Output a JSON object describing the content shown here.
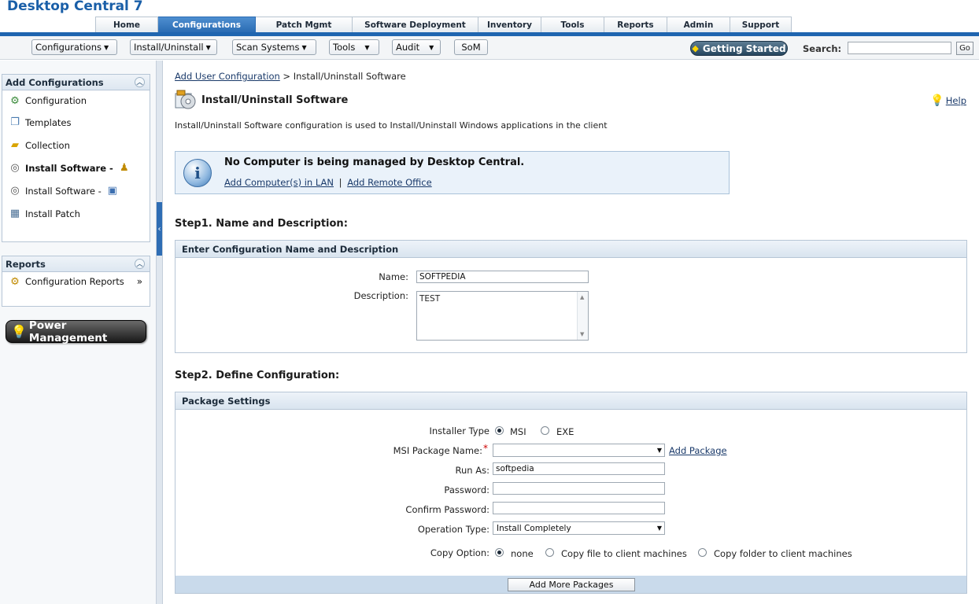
{
  "app": {
    "title": "Desktop Central 7"
  },
  "main_tabs": [
    {
      "label": "Home",
      "active": false
    },
    {
      "label": "Configurations",
      "active": true
    },
    {
      "label": "Patch Mgmt",
      "active": false
    },
    {
      "label": "Software Deployment",
      "active": false
    },
    {
      "label": "Inventory",
      "active": false
    },
    {
      "label": "Tools",
      "active": false
    },
    {
      "label": "Reports",
      "active": false
    },
    {
      "label": "Admin",
      "active": false
    },
    {
      "label": "Support",
      "active": false
    }
  ],
  "toolbar": {
    "menus": [
      {
        "label": "Configurations",
        "caret": "▼"
      },
      {
        "label": "Install/Uninstall",
        "caret": "▼"
      },
      {
        "label": "Scan Systems",
        "caret": "▼"
      },
      {
        "label": "Tools",
        "caret": "▼"
      },
      {
        "label": "Audit",
        "caret": "▼"
      },
      {
        "label": "SoM",
        "caret": ""
      }
    ],
    "getting_started": "Getting Started",
    "search_label": "Search:",
    "search_value": "",
    "go_label": "Go"
  },
  "sidebar": {
    "add_config_title": "Add Configurations",
    "add_config_items": [
      {
        "label": "Configuration",
        "icon": "gear-add-icon"
      },
      {
        "label": "Templates",
        "icon": "templates-icon"
      },
      {
        "label": "Collection",
        "icon": "collection-icon"
      },
      {
        "label": "Install Software -",
        "icon": "software-cd-icon",
        "suffix_icon": "user-icon"
      },
      {
        "label": "Install Software -",
        "icon": "software-cd-icon",
        "suffix_icon": "computer-icon"
      },
      {
        "label": "Install Patch",
        "icon": "patch-icon"
      }
    ],
    "reports_title": "Reports",
    "reports_items": [
      {
        "label": "Configuration Reports",
        "icon": "reports-gear-icon"
      }
    ],
    "power_management": "Power Management"
  },
  "content": {
    "breadcrumb_link": "Add User Configuration",
    "breadcrumb_sep": " > ",
    "breadcrumb_current": "Install/Uninstall Software",
    "page_title": "Install/Uninstall Software",
    "help_label": "Help",
    "description": "Install/Uninstall Software configuration is used to Install/Uninstall Windows applications in the client",
    "info": {
      "title": "No Computer is being managed by Desktop Central.",
      "link1": "Add Computer(s) in LAN",
      "separator": "|",
      "link2": "Add Remote Office"
    },
    "step1": {
      "title": "Step1. Name and Description:",
      "section_title": "Enter Configuration Name and Description",
      "name_label": "Name:",
      "name_value": "SOFTPEDIA",
      "description_label": "Description:",
      "description_value": "TEST"
    },
    "step2": {
      "title": "Step2. Define Configuration:",
      "section_title": "Package Settings",
      "installer_type_label": "Installer Type",
      "installer_options": [
        {
          "label": "MSI",
          "checked": true
        },
        {
          "label": "EXE",
          "checked": false
        }
      ],
      "msi_package_label": "MSI Package Name:",
      "required_mark": "*",
      "msi_package_value": "",
      "add_package_link": "Add Package",
      "run_as_label": "Run As:",
      "run_as_value": "softpedia",
      "password_label": "Password:",
      "password_value": "",
      "confirm_password_label": "Confirm Password:",
      "confirm_password_value": "",
      "operation_type_label": "Operation Type:",
      "operation_type_value": "Install Completely",
      "copy_option_label": "Copy Option:",
      "copy_options": [
        {
          "label": "none",
          "checked": true
        },
        {
          "label": "Copy file to client machines",
          "checked": false
        },
        {
          "label": "Copy folder to client machines",
          "checked": false
        }
      ],
      "add_more_label": "Add More Packages"
    }
  },
  "colors": {
    "brand_blue": "#1f65b0",
    "active_tab": "#2a6bb3",
    "required_red": "#cc0000"
  }
}
